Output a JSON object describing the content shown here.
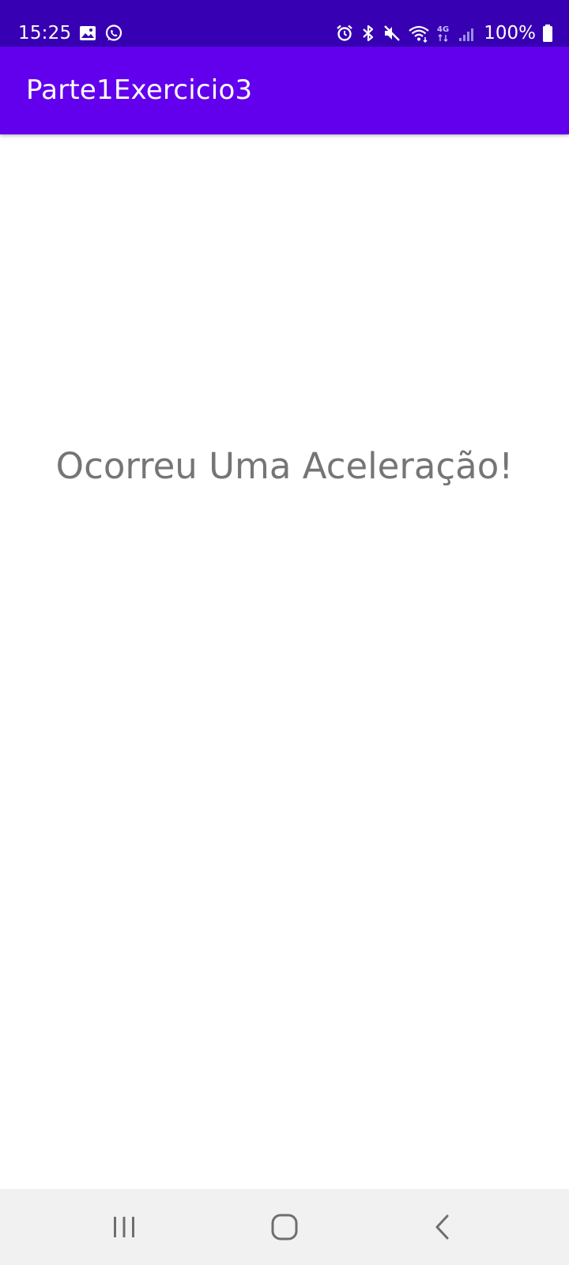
{
  "status_bar": {
    "time": "15:25",
    "battery_percent": "100%",
    "background_color": "#3700B3",
    "left_icons": [
      "image-icon",
      "whatsapp-icon"
    ],
    "right_icons": [
      "alarm-icon",
      "bluetooth-icon",
      "mute-icon",
      "wifi-icon",
      "network-4g-icon",
      "signal-icon",
      "battery-icon"
    ],
    "network_label": "4G"
  },
  "app_bar": {
    "title": "Parte1Exercicio3",
    "background_color": "#6200EE"
  },
  "main": {
    "message": "Ocorreu Uma Aceleração!",
    "text_color": "#757575"
  },
  "nav_bar": {
    "background_color": "#F1F1F1",
    "buttons": [
      "recent-apps-icon",
      "home-icon",
      "back-icon"
    ]
  }
}
